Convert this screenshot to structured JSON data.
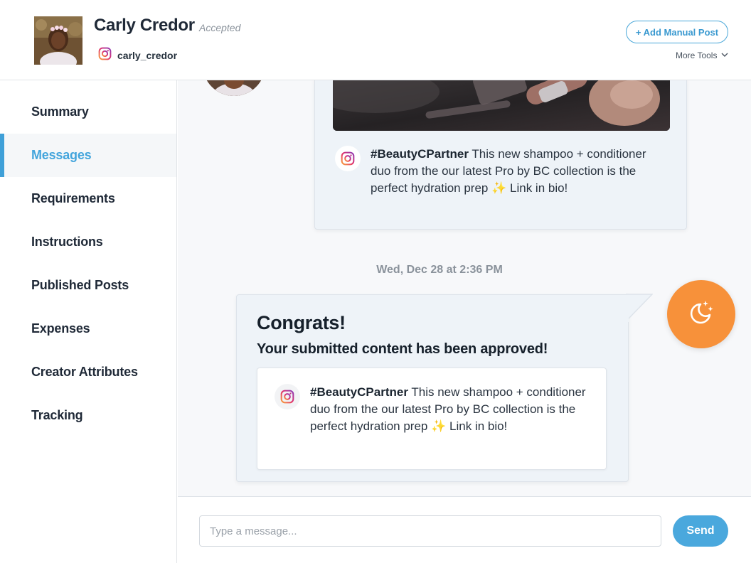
{
  "header": {
    "creator_name": "Carly Credor",
    "status": "Accepted",
    "instagram_handle": "carly_credor",
    "add_post_label": "+ Add Manual Post",
    "more_tools_label": "More Tools"
  },
  "sidebar": {
    "items": [
      {
        "label": "Summary",
        "active": false
      },
      {
        "label": "Messages",
        "active": true
      },
      {
        "label": "Requirements",
        "active": false
      },
      {
        "label": "Instructions",
        "active": false
      },
      {
        "label": "Published Posts",
        "active": false
      },
      {
        "label": "Expenses",
        "active": false
      },
      {
        "label": "Creator Attributes",
        "active": false
      },
      {
        "label": "Tracking",
        "active": false
      }
    ]
  },
  "chat": {
    "previous_post": {
      "hashtag": "#BeautyCPartner",
      "caption": " This new shampoo + conditioner duo from the our latest Pro by BC collection is the perfect hydration prep ",
      "sparkle": "✨",
      "caption_end": " Link in bio!"
    },
    "timestamp": "Wed, Dec 28 at 2:36 PM",
    "message": {
      "title": "Congrats!",
      "subtitle": "Your submitted content has been approved!",
      "post": {
        "hashtag": "#BeautyCPartner",
        "caption": " This new shampoo + conditioner duo from the our latest Pro by BC collection is the perfect hydration prep ",
        "sparkle": "✨",
        "caption_end": " Link in bio!"
      }
    }
  },
  "composer": {
    "placeholder": "Type a message...",
    "send_label": "Send"
  },
  "colors": {
    "accent": "#44a5dc",
    "moon_button": "#f7913a",
    "send_button": "#4aa8dd"
  },
  "icons": {
    "instagram": "instagram-icon",
    "moon": "moon-stars-icon",
    "chevron": "chevron-down-icon"
  }
}
